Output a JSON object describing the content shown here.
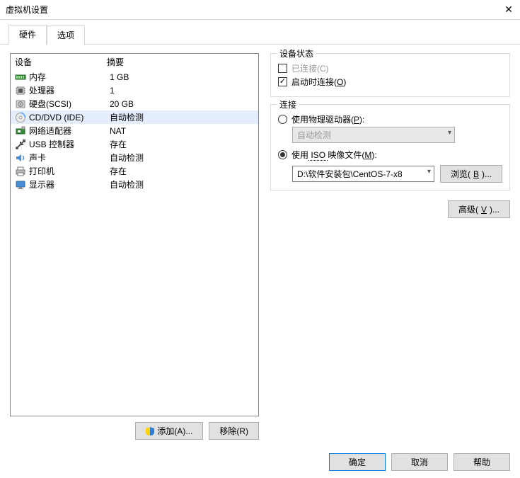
{
  "window": {
    "title": "虚拟机设置"
  },
  "tabs": {
    "hardware": "硬件",
    "options": "选项"
  },
  "headers": {
    "device": "设备",
    "summary": "摘要"
  },
  "hw": [
    {
      "name": "内存",
      "summary": "1 GB",
      "icon": "memory"
    },
    {
      "name": "处理器",
      "summary": "1",
      "icon": "cpu"
    },
    {
      "name": "硬盘(SCSI)",
      "summary": "20 GB",
      "icon": "hdd"
    },
    {
      "name": "CD/DVD (IDE)",
      "summary": "自动检测",
      "icon": "cd",
      "selected": true
    },
    {
      "name": "网络适配器",
      "summary": "NAT",
      "icon": "nic"
    },
    {
      "name": "USB 控制器",
      "summary": "存在",
      "icon": "usb"
    },
    {
      "name": "声卡",
      "summary": "自动检测",
      "icon": "sound"
    },
    {
      "name": "打印机",
      "summary": "存在",
      "icon": "printer"
    },
    {
      "name": "显示器",
      "summary": "自动检测",
      "icon": "display"
    }
  ],
  "buttons": {
    "add": "添加(A)...",
    "remove": "移除(R)",
    "browse": "浏览(B)...",
    "advanced": "高级(V)...",
    "ok": "确定",
    "cancel": "取消",
    "help": "帮助"
  },
  "status_group": {
    "legend": "设备状态",
    "connected": "已连接(C)",
    "connect_at_poweron": "启动时连接(O)"
  },
  "conn_group": {
    "legend": "连接",
    "use_physical": "使用物理驱动器(P):",
    "physical_value": "自动检测",
    "use_iso_pre": "使用",
    "use_iso_mid": "ISO",
    "use_iso_post": "映像文件(M):",
    "iso_path": "D:\\软件安装包\\CentOS-7-x8"
  }
}
